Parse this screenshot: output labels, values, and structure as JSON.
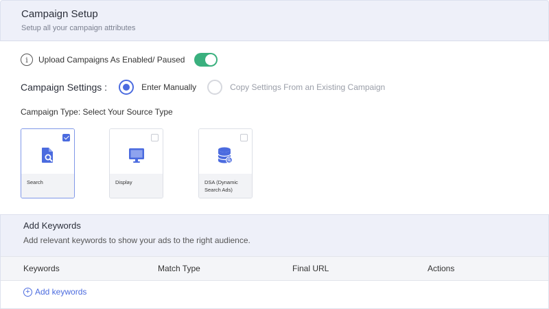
{
  "header": {
    "title": "Campaign Setup",
    "subtitle": "Setup all your campaign attributes"
  },
  "upload": {
    "info_icon": "info-icon",
    "label": "Upload Campaigns As Enabled/ Paused",
    "toggle_on": true
  },
  "settings": {
    "label": "Campaign Settings :",
    "options": [
      {
        "label": "Enter Manually",
        "selected": true
      },
      {
        "label": "Copy Settings From an Existing Campaign",
        "selected": false
      }
    ]
  },
  "campaign_type": {
    "label": "Campaign Type: Select Your Source Type",
    "cards": [
      {
        "label": "Search",
        "icon": "search-document-icon",
        "selected": true
      },
      {
        "label": "Display",
        "icon": "monitor-icon",
        "selected": false
      },
      {
        "label": "DSA (Dynamic Search Ads)",
        "icon": "database-search-icon",
        "selected": false
      }
    ]
  },
  "keywords": {
    "title": "Add Keywords",
    "subtitle": "Add relevant keywords to show your ads to the right audience.",
    "columns": [
      "Keywords",
      "Match Type",
      "Final URL",
      "Actions"
    ],
    "add_label": "Add keywords"
  },
  "colors": {
    "accent": "#4b6bdf",
    "toggle": "#3ab07e",
    "header_bg": "#eef0f9"
  }
}
